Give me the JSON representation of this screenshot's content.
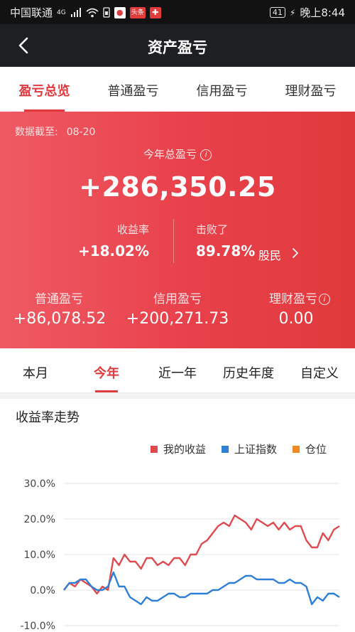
{
  "status_bar": {
    "carrier": "中国联通",
    "network": "4G",
    "app_badge_1": "头条",
    "battery": "41",
    "time": "晚上8:44"
  },
  "nav": {
    "title": "资产盈亏",
    "back_icon": "chevron-left-icon"
  },
  "top_tabs": [
    {
      "label": "盈亏总览",
      "active": true
    },
    {
      "label": "普通盈亏",
      "active": false
    },
    {
      "label": "信用盈亏",
      "active": false
    },
    {
      "label": "理财盈亏",
      "active": false
    }
  ],
  "summary": {
    "date_label": "数据截至:",
    "date_value": "08-20",
    "total_label": "今年总盈亏",
    "total_value": "+286,350.25",
    "rate_label": "收益率",
    "rate_value": "+18.02%",
    "beat_label": "击败了",
    "beat_value": "89.78%",
    "beat_unit": "股民",
    "normal_label": "普通盈亏",
    "normal_value": "+86,078.52",
    "credit_label": "信用盈亏",
    "credit_value": "+200,271.73",
    "finance_label": "理财盈亏",
    "finance_value": "0.00"
  },
  "period_tabs": [
    {
      "label": "本月",
      "active": false
    },
    {
      "label": "今年",
      "active": true
    },
    {
      "label": "近一年",
      "active": false
    },
    {
      "label": "历史年度",
      "active": false
    },
    {
      "label": "自定义",
      "active": false
    }
  ],
  "colors": {
    "accent": "#e0393e",
    "my_return": "#e04a4f",
    "index": "#2f7fd6",
    "position": "#f08a24"
  },
  "chart_data": {
    "type": "line",
    "title": "收益率走势",
    "y_ticks": [
      "30.0%",
      "20.0%",
      "10.0%",
      "0.0%",
      "-10.0%"
    ],
    "ylim": [
      -10,
      30
    ],
    "grid": true,
    "legend_position": "top-right",
    "series": [
      {
        "name": "我的收益",
        "color": "#e04a4f",
        "x": [
          0,
          2,
          4,
          6,
          8,
          10,
          12,
          14,
          16,
          18,
          20,
          22,
          24,
          26,
          28,
          30,
          32,
          34,
          36,
          38,
          40,
          42,
          44,
          46,
          48,
          50,
          52,
          54,
          56,
          58,
          60,
          62,
          64,
          66,
          68,
          70,
          72,
          74,
          76,
          78,
          80,
          82,
          84,
          86,
          88,
          90,
          92,
          94,
          96,
          98,
          100
        ],
        "values": [
          0,
          2,
          1,
          3,
          2,
          1,
          -1,
          1,
          0,
          9,
          7,
          10,
          8,
          8,
          6,
          9,
          9,
          7,
          8,
          7,
          9,
          9,
          7,
          10,
          10,
          13,
          14,
          16,
          18,
          19,
          18,
          21,
          20,
          19,
          17,
          20,
          19,
          18,
          19,
          17,
          19,
          17,
          18,
          18,
          14,
          12,
          12,
          16,
          14,
          17,
          18
        ]
      },
      {
        "name": "上证指数",
        "color": "#2f7fd6",
        "x": [
          0,
          2,
          4,
          6,
          8,
          10,
          12,
          14,
          16,
          18,
          20,
          22,
          24,
          26,
          28,
          30,
          32,
          34,
          36,
          38,
          40,
          42,
          44,
          46,
          48,
          50,
          52,
          54,
          56,
          58,
          60,
          62,
          64,
          66,
          68,
          70,
          72,
          74,
          76,
          78,
          80,
          82,
          84,
          86,
          88,
          90,
          92,
          94,
          96,
          98,
          100
        ],
        "values": [
          0,
          2,
          2,
          3,
          3,
          1,
          0,
          0,
          1,
          5,
          1,
          1,
          -2,
          -3,
          -4,
          -2,
          -3,
          -3,
          -2,
          -1,
          -1,
          -2,
          -2,
          -1,
          -1,
          -1,
          -1,
          0,
          0,
          1,
          2,
          2,
          3,
          4,
          4,
          3,
          3,
          3,
          3,
          2,
          2,
          3,
          2,
          2,
          1,
          -4,
          -2,
          -3,
          -1,
          -1,
          -2
        ]
      },
      {
        "name": "仓位",
        "color": "#f08a24",
        "x": [],
        "values": []
      }
    ]
  }
}
